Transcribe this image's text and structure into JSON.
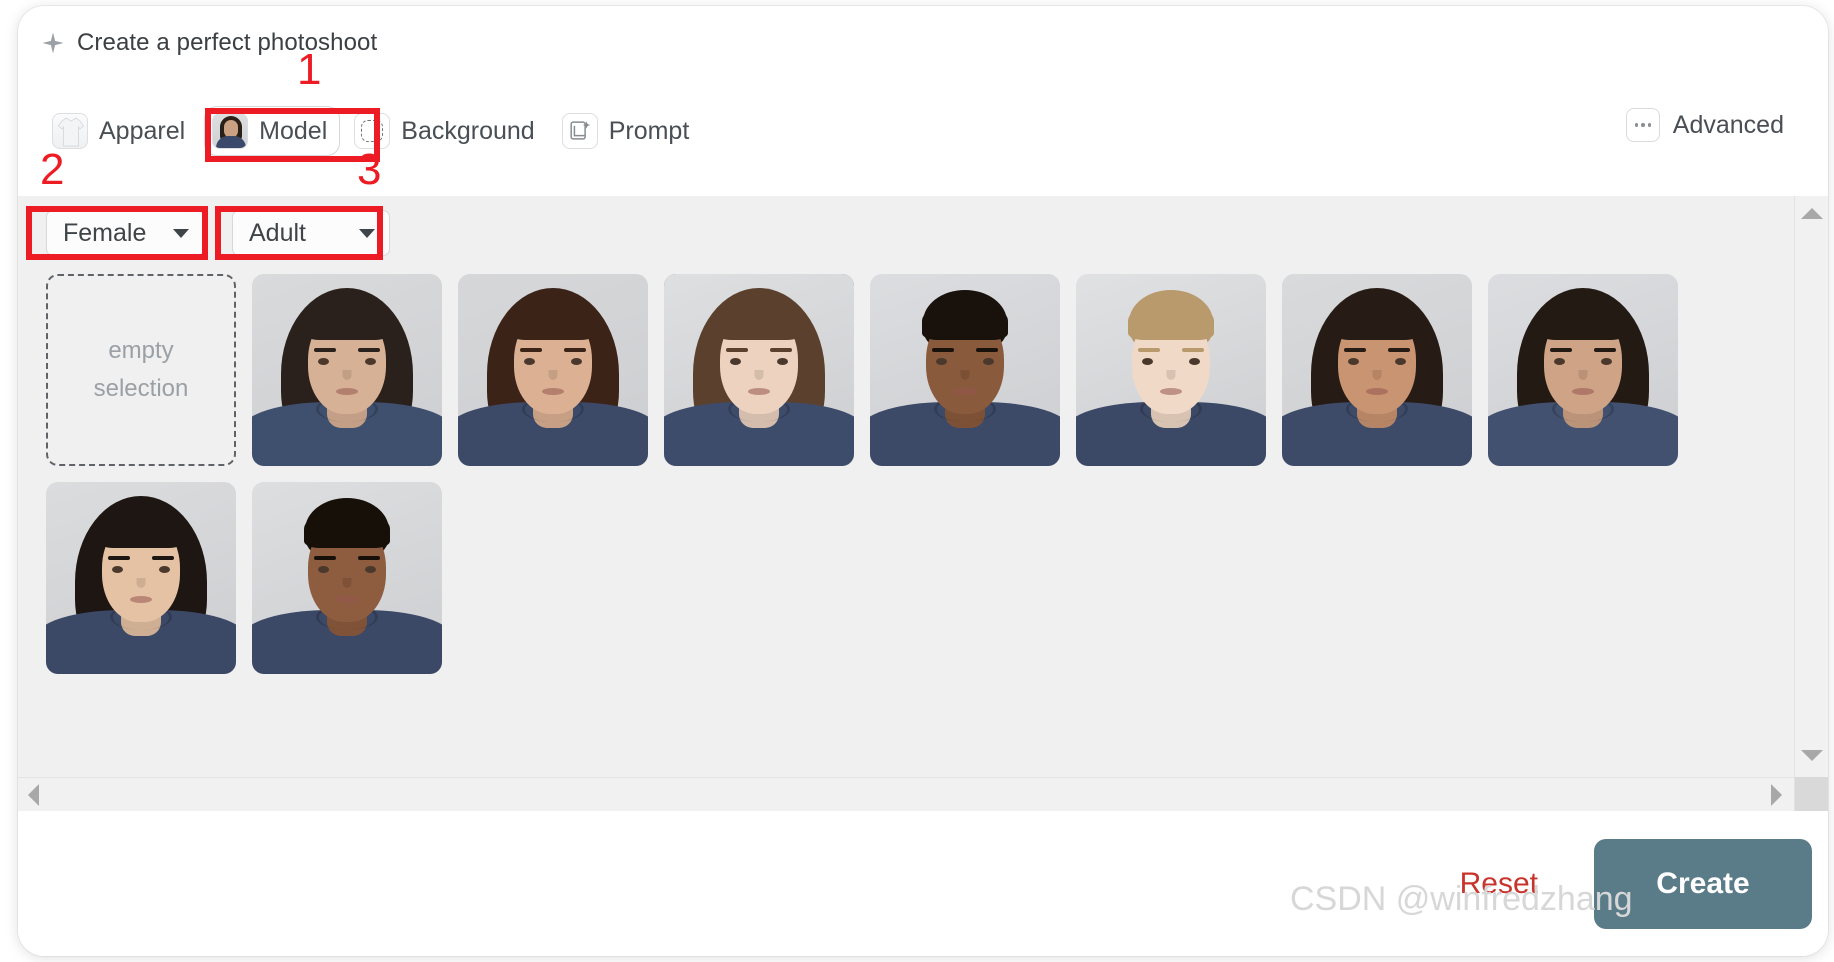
{
  "header": {
    "title": "Create a perfect photoshoot",
    "sparkle_icon": "sparkle-icon"
  },
  "tabs": [
    {
      "id": "apparel",
      "label": "Apparel",
      "icon": "apparel-icon",
      "active": false
    },
    {
      "id": "model",
      "label": "Model",
      "icon": "model-icon",
      "active": true
    },
    {
      "id": "background",
      "label": "Background",
      "icon": "background-icon",
      "active": false
    },
    {
      "id": "prompt",
      "label": "Prompt",
      "icon": "prompt-icon",
      "active": false
    }
  ],
  "advanced": {
    "label": "Advanced",
    "icon": "ellipsis-icon"
  },
  "selectors": [
    {
      "id": "gender",
      "value": "Female",
      "caret": "chevron-down-icon"
    },
    {
      "id": "age",
      "value": "Adult",
      "caret": "chevron-down-icon"
    }
  ],
  "gallery": {
    "empty_tile": {
      "line1": "empty",
      "line2": "selection"
    },
    "selected_index": 2,
    "items": [
      {
        "id": "model-1",
        "alt": "Woman with long dark hair, light olive skin",
        "skin": "#d7b195",
        "hair": "#2b211c",
        "shirt": "#3f4f6e",
        "bg": "#d9dadc",
        "style": "long"
      },
      {
        "id": "model-2",
        "alt": "Woman with long brown hair, medium skin",
        "skin": "#dcb193",
        "hair": "#3c2318",
        "shirt": "#3c4a68",
        "bg": "#d6d7d9",
        "style": "long"
      },
      {
        "id": "model-3",
        "alt": "Woman with long light brown hair, fair skin",
        "skin": "#ecd2bf",
        "hair": "#5b402d",
        "shirt": "#3e4c6b",
        "bg": "#dedfe1",
        "style": "long"
      },
      {
        "id": "model-4",
        "alt": "Woman with braided hair, deep skin tone",
        "skin": "#8a5a3c",
        "hair": "#19110c",
        "shirt": "#3c4a68",
        "bg": "#dcdde0",
        "style": "up"
      },
      {
        "id": "model-5",
        "alt": "Woman with blonde updo, fair skin",
        "skin": "#f0d9c7",
        "hair": "#b99a6d",
        "shirt": "#3b4966",
        "bg": "#e0e1e3",
        "style": "up"
      },
      {
        "id": "model-6",
        "alt": "Woman with long dark wavy hair, medium skin",
        "skin": "#c99471",
        "hair": "#271c15",
        "shirt": "#3d4b69",
        "bg": "#d9dadc",
        "style": "long"
      },
      {
        "id": "model-7",
        "alt": "Woman with dark hair pulled back, medium skin",
        "skin": "#cfa385",
        "hair": "#241a14",
        "shirt": "#42517040",
        "bg": "#dcdde0",
        "style": "long"
      },
      {
        "id": "model-8",
        "alt": "Woman with long black hair, light skin",
        "skin": "#e6c2a4",
        "hair": "#1d1612",
        "shirt": "#3b4966",
        "bg": "#dbdcde",
        "style": "long"
      },
      {
        "id": "model-9",
        "alt": "Woman with braided updo, deep skin tone",
        "skin": "#8e5c3e",
        "hair": "#171009",
        "shirt": "#3b4966",
        "bg": "#dddee0",
        "style": "up"
      }
    ]
  },
  "footer": {
    "reset_label": "Reset",
    "create_label": "Create"
  },
  "watermark": "CSDN @winfredzhang",
  "scrollbars": {
    "vertical": {
      "up": "arrow-up-icon",
      "down": "arrow-down-icon"
    },
    "horizontal": {
      "left": "arrow-left-icon",
      "right": "arrow-right-icon"
    }
  },
  "annotations": [
    {
      "id": "anno-1",
      "number": "1",
      "target": "model-tab"
    },
    {
      "id": "anno-2",
      "number": "2",
      "target": "gender-select"
    },
    {
      "id": "anno-3",
      "number": "3",
      "target": "age-select"
    }
  ],
  "colors": {
    "accent": "#597c88",
    "selected_border": "#4d7c89",
    "reset": "#c8342b",
    "annotation": "#ed1c24",
    "content_bg": "#f0f0f0"
  }
}
